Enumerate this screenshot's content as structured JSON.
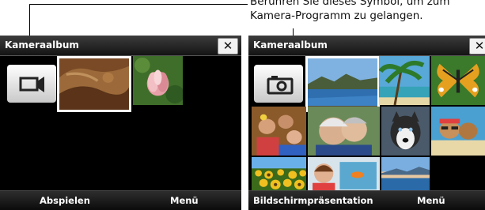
{
  "callout": {
    "line1": "Berühren Sie dieses Symbol, um zum",
    "line2": "Kamera-Programm zu gelangen."
  },
  "left_screen": {
    "title": "Kameraalbum",
    "close_label": "✕",
    "softkeys": {
      "left": "Abspielen",
      "right": "Menü"
    },
    "camera_icon": "video-camera-icon",
    "thumbnails": [
      "rock-landscape",
      "lotus-flower"
    ]
  },
  "right_screen": {
    "title": "Kameraalbum",
    "close_label": "✕",
    "softkeys": {
      "left": "Bildschirmpräsentation",
      "right": "Menü"
    },
    "camera_icon": "photo-camera-icon",
    "thumbnails": [
      "lake-mountains",
      "palm-beach",
      "butterfly",
      "family-party",
      "elderly-couple",
      "husky-dog",
      "beach-couple",
      "sunflower-field",
      "child-with-aquarium",
      "sunset-coast"
    ]
  },
  "colors": {
    "screen_bg": "#000000",
    "title_bar": "#1f1f1f",
    "selection_border": "#ffffff"
  }
}
